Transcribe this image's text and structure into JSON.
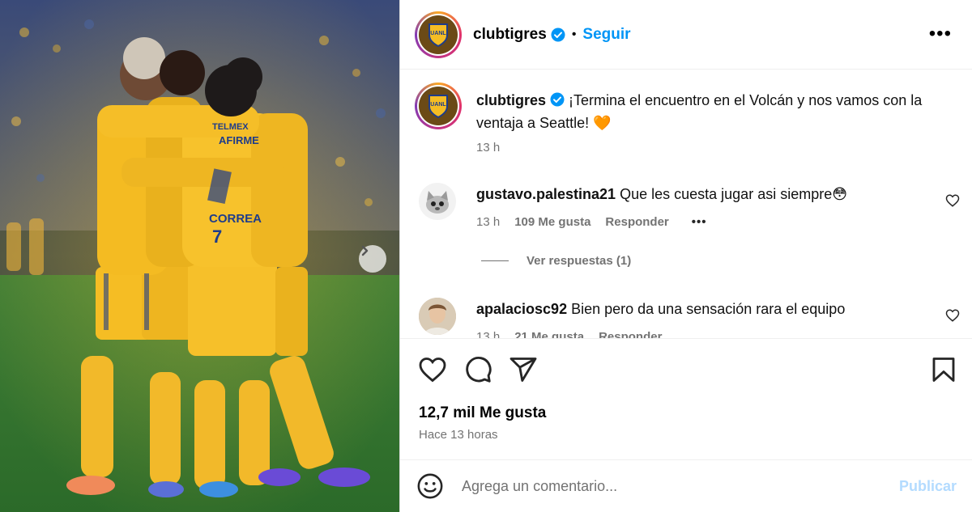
{
  "post": {
    "username": "clubtigres",
    "follow_label": "Seguir",
    "more_icon": "more-horizontal-icon",
    "caption": "¡Termina el encuentro en el Volcán y nos vamos con la ventaja a Seattle! 🧡",
    "caption_time": "13 h",
    "photo_icon": "team-celebration-photo"
  },
  "comments": [
    {
      "username": "gustavo.palestina21",
      "text": "Que les cuesta jugar asi siempre😳",
      "time": "13 h",
      "likes": "109 Me gusta",
      "reply_label": "Responder",
      "more": "•••",
      "view_replies": "Ver respuestas (1)"
    },
    {
      "username": "apalaciosc92",
      "text": "Bien pero da una sensación rara el equipo",
      "time": "13 h",
      "likes": "21 Me gusta",
      "reply_label": "Responder"
    }
  ],
  "actions": {
    "likes_count": "12,7 mil Me gusta",
    "posted_ago": "Hace 13 horas"
  },
  "composer": {
    "placeholder": "Agrega un comentario...",
    "publish_label": "Publicar"
  },
  "colors": {
    "accent": "#0095f6",
    "publish_disabled": "#b3dbff",
    "muted": "#737373",
    "jersey": "#f5b921"
  }
}
